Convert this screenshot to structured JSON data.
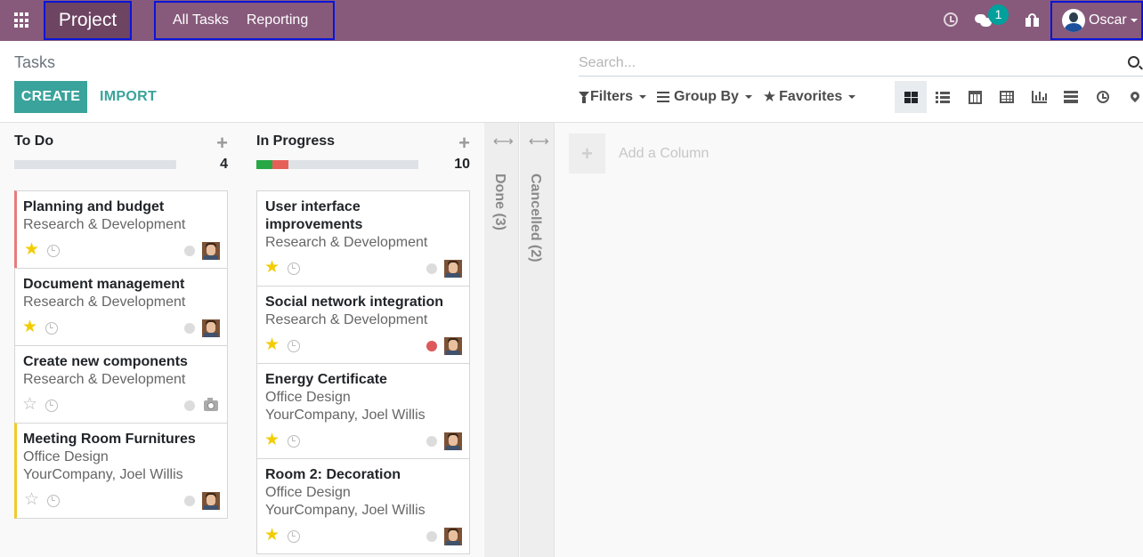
{
  "navbar": {
    "app_name": "Project",
    "menu": [
      "All Tasks",
      "Reporting"
    ],
    "messages_count": "1",
    "user_name": "Oscar"
  },
  "control": {
    "breadcrumb": "Tasks",
    "create_label": "CREATE",
    "import_label": "IMPORT",
    "search_placeholder": "Search...",
    "filters_label": "Filters",
    "groupby_label": "Group By",
    "favorites_label": "Favorites",
    "views": [
      "kanban",
      "list",
      "calendar",
      "pivot",
      "graph",
      "cohort",
      "activity",
      "map"
    ],
    "active_view": "kanban"
  },
  "columns": [
    {
      "title": "To Do",
      "count": "4",
      "progress": {
        "green": 0,
        "red": 0
      },
      "cards": [
        {
          "title": "Planning and budget",
          "lines": [
            "Research & Development"
          ],
          "priority": true,
          "state": "grey",
          "border": "red",
          "avatar": "user"
        },
        {
          "title": "Document management",
          "lines": [
            "Research & Development"
          ],
          "priority": true,
          "state": "grey",
          "border": "none",
          "avatar": "user"
        },
        {
          "title": "Create new components",
          "lines": [
            "Research & Development"
          ],
          "priority": false,
          "state": "grey",
          "border": "none",
          "avatar": "camera"
        },
        {
          "title": "Meeting Room Furnitures",
          "lines": [
            "Office Design",
            "YourCompany, Joel Willis"
          ],
          "priority": false,
          "state": "grey",
          "border": "yellow",
          "avatar": "user"
        }
      ]
    },
    {
      "title": "In Progress",
      "count": "10",
      "progress": {
        "green": 0.1,
        "red": 0.1
      },
      "cards": [
        {
          "title_lines": [
            "User interface",
            "improvements"
          ],
          "lines": [
            "Research & Development"
          ],
          "priority": true,
          "state": "grey",
          "avatar": "user"
        },
        {
          "title": "Social network integration",
          "lines": [
            "Research & Development"
          ],
          "priority": true,
          "state": "red",
          "avatar": "user"
        },
        {
          "title": "Energy Certificate",
          "lines": [
            "Office Design",
            "YourCompany, Joel Willis"
          ],
          "priority": true,
          "state": "grey",
          "avatar": "user"
        },
        {
          "title": "Room 2: Decoration",
          "lines": [
            "Office Design",
            "YourCompany, Joel Willis"
          ],
          "priority": true,
          "state": "grey",
          "avatar": "user"
        }
      ]
    }
  ],
  "folded_columns": [
    "Done (3)",
    "Cancelled (2)"
  ],
  "add_column_label": "Add a Column",
  "colors": {
    "nav": "#875a7b",
    "accent": "#3aa39b",
    "badge": "#00a09d"
  }
}
